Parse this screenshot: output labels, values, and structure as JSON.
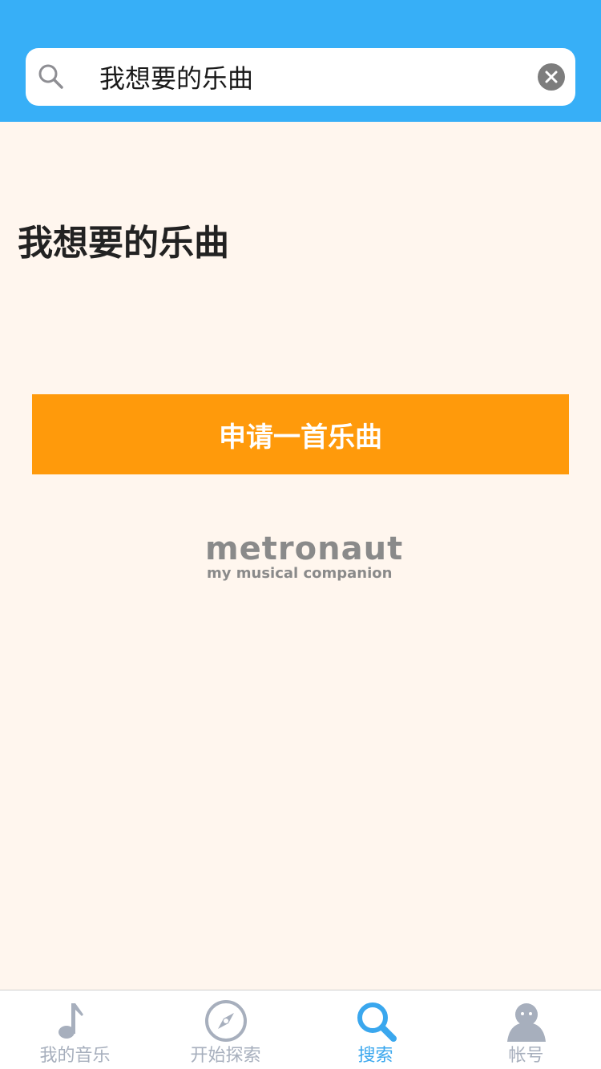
{
  "colors": {
    "header_bg": "#37aff7",
    "page_bg": "#fff6ee",
    "accent_orange": "#ff9a0b",
    "tab_active": "#3aa7ee",
    "tab_inactive": "#a7afbd"
  },
  "search": {
    "value": "我想要的乐曲",
    "icon": "search-icon",
    "clear_icon": "clear-icon"
  },
  "main": {
    "title": "我想要的乐曲",
    "request_button_label": "申请一首乐曲"
  },
  "logo": {
    "word": "metronaut",
    "tagline": "my musical companion"
  },
  "tabs": [
    {
      "label": "我的音乐",
      "icon": "music-note-icon",
      "active": false
    },
    {
      "label": "开始探索",
      "icon": "compass-icon",
      "active": false
    },
    {
      "label": "搜索",
      "icon": "search-icon",
      "active": true
    },
    {
      "label": "帐号",
      "icon": "user-icon",
      "active": false
    }
  ]
}
